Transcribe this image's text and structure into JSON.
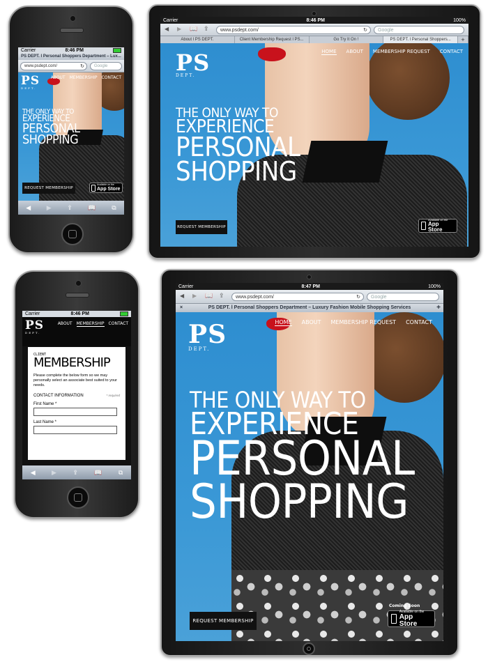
{
  "status": {
    "carrier": "Carrier",
    "time_a": "8:46 PM",
    "time_b": "8:47 PM",
    "battery": "100%"
  },
  "browser": {
    "url": "www.psdept.com/",
    "search_placeholder": "Google",
    "page_title": "PS DEPT. l Personal Shoppers Department – Luxury Fashion Mobile Shopping Services",
    "page_title_short": "PS DEPT. l Personal Shoppers Department – Lux...",
    "tabs": [
      "About l PS DEPT.",
      "Client Membership Request l PS...",
      "Go Try It On !",
      "PS DEPT. l Personal Shoppers..."
    ]
  },
  "site": {
    "logo_ps": "PS",
    "logo_dept": "DEPT.",
    "nav": [
      "HOME",
      "ABOUT",
      "MEMBERSHIP REQUEST",
      "CONTACT"
    ],
    "nav_phone": [
      "ABOUT",
      "MEMBERSHIP",
      "CONTACT"
    ],
    "headline": [
      "THE ONLY WAY TO",
      "EXPERIENCE",
      "PERSONAL",
      "SHOPPING"
    ],
    "request_button": "REQUEST MEMBERSHIP",
    "appstore_small": "Available on the",
    "appstore_big": "App Store",
    "coming_soon": "Coming Soon"
  },
  "membership": {
    "client": "CLIENT",
    "title": "MEMBERSHIP",
    "intro": "Please complete the below form so we may personally select an associate best suited to your needs.",
    "section": "CONTACT INFORMATION",
    "required": "* required",
    "first_name": "First Name *",
    "last_name": "Last Name *"
  },
  "icons": {
    "back": "back-arrow-icon",
    "forward": "forward-arrow-icon",
    "share": "share-icon",
    "bookmarks": "bookmarks-icon",
    "tabs": "tabs-icon",
    "reload": "reload-icon"
  },
  "colors": {
    "sky": "#2f8cc8",
    "lips": "#c8121c",
    "button": "#111111"
  }
}
